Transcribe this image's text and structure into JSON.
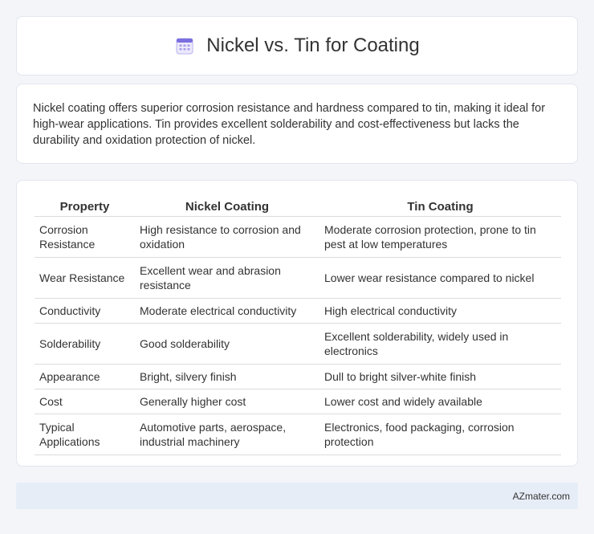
{
  "header": {
    "title": "Nickel vs. Tin for Coating",
    "icon": "calendar-icon",
    "icon_color": "#7b6fe0"
  },
  "intro": {
    "text": "Nickel coating offers superior corrosion resistance and hardness compared to tin, making it ideal for high-wear applications. Tin provides excellent solderability and cost-effectiveness but lacks the durability and oxidation protection of nickel."
  },
  "table": {
    "headers": [
      "Property",
      "Nickel Coating",
      "Tin Coating"
    ],
    "rows": [
      [
        "Corrosion Resistance",
        "High resistance to corrosion and oxidation",
        "Moderate corrosion protection, prone to tin pest at low temperatures"
      ],
      [
        "Wear Resistance",
        "Excellent wear and abrasion resistance",
        "Lower wear resistance compared to nickel"
      ],
      [
        "Conductivity",
        "Moderate electrical conductivity",
        "High electrical conductivity"
      ],
      [
        "Solderability",
        "Good solderability",
        "Excellent solderability, widely used in electronics"
      ],
      [
        "Appearance",
        "Bright, silvery finish",
        "Dull to bright silver-white finish"
      ],
      [
        "Cost",
        "Generally higher cost",
        "Lower cost and widely available"
      ],
      [
        "Typical Applications",
        "Automotive parts, aerospace, industrial machinery",
        "Electronics, food packaging, corrosion protection"
      ]
    ]
  },
  "footer": {
    "text": "AZmater.com"
  }
}
